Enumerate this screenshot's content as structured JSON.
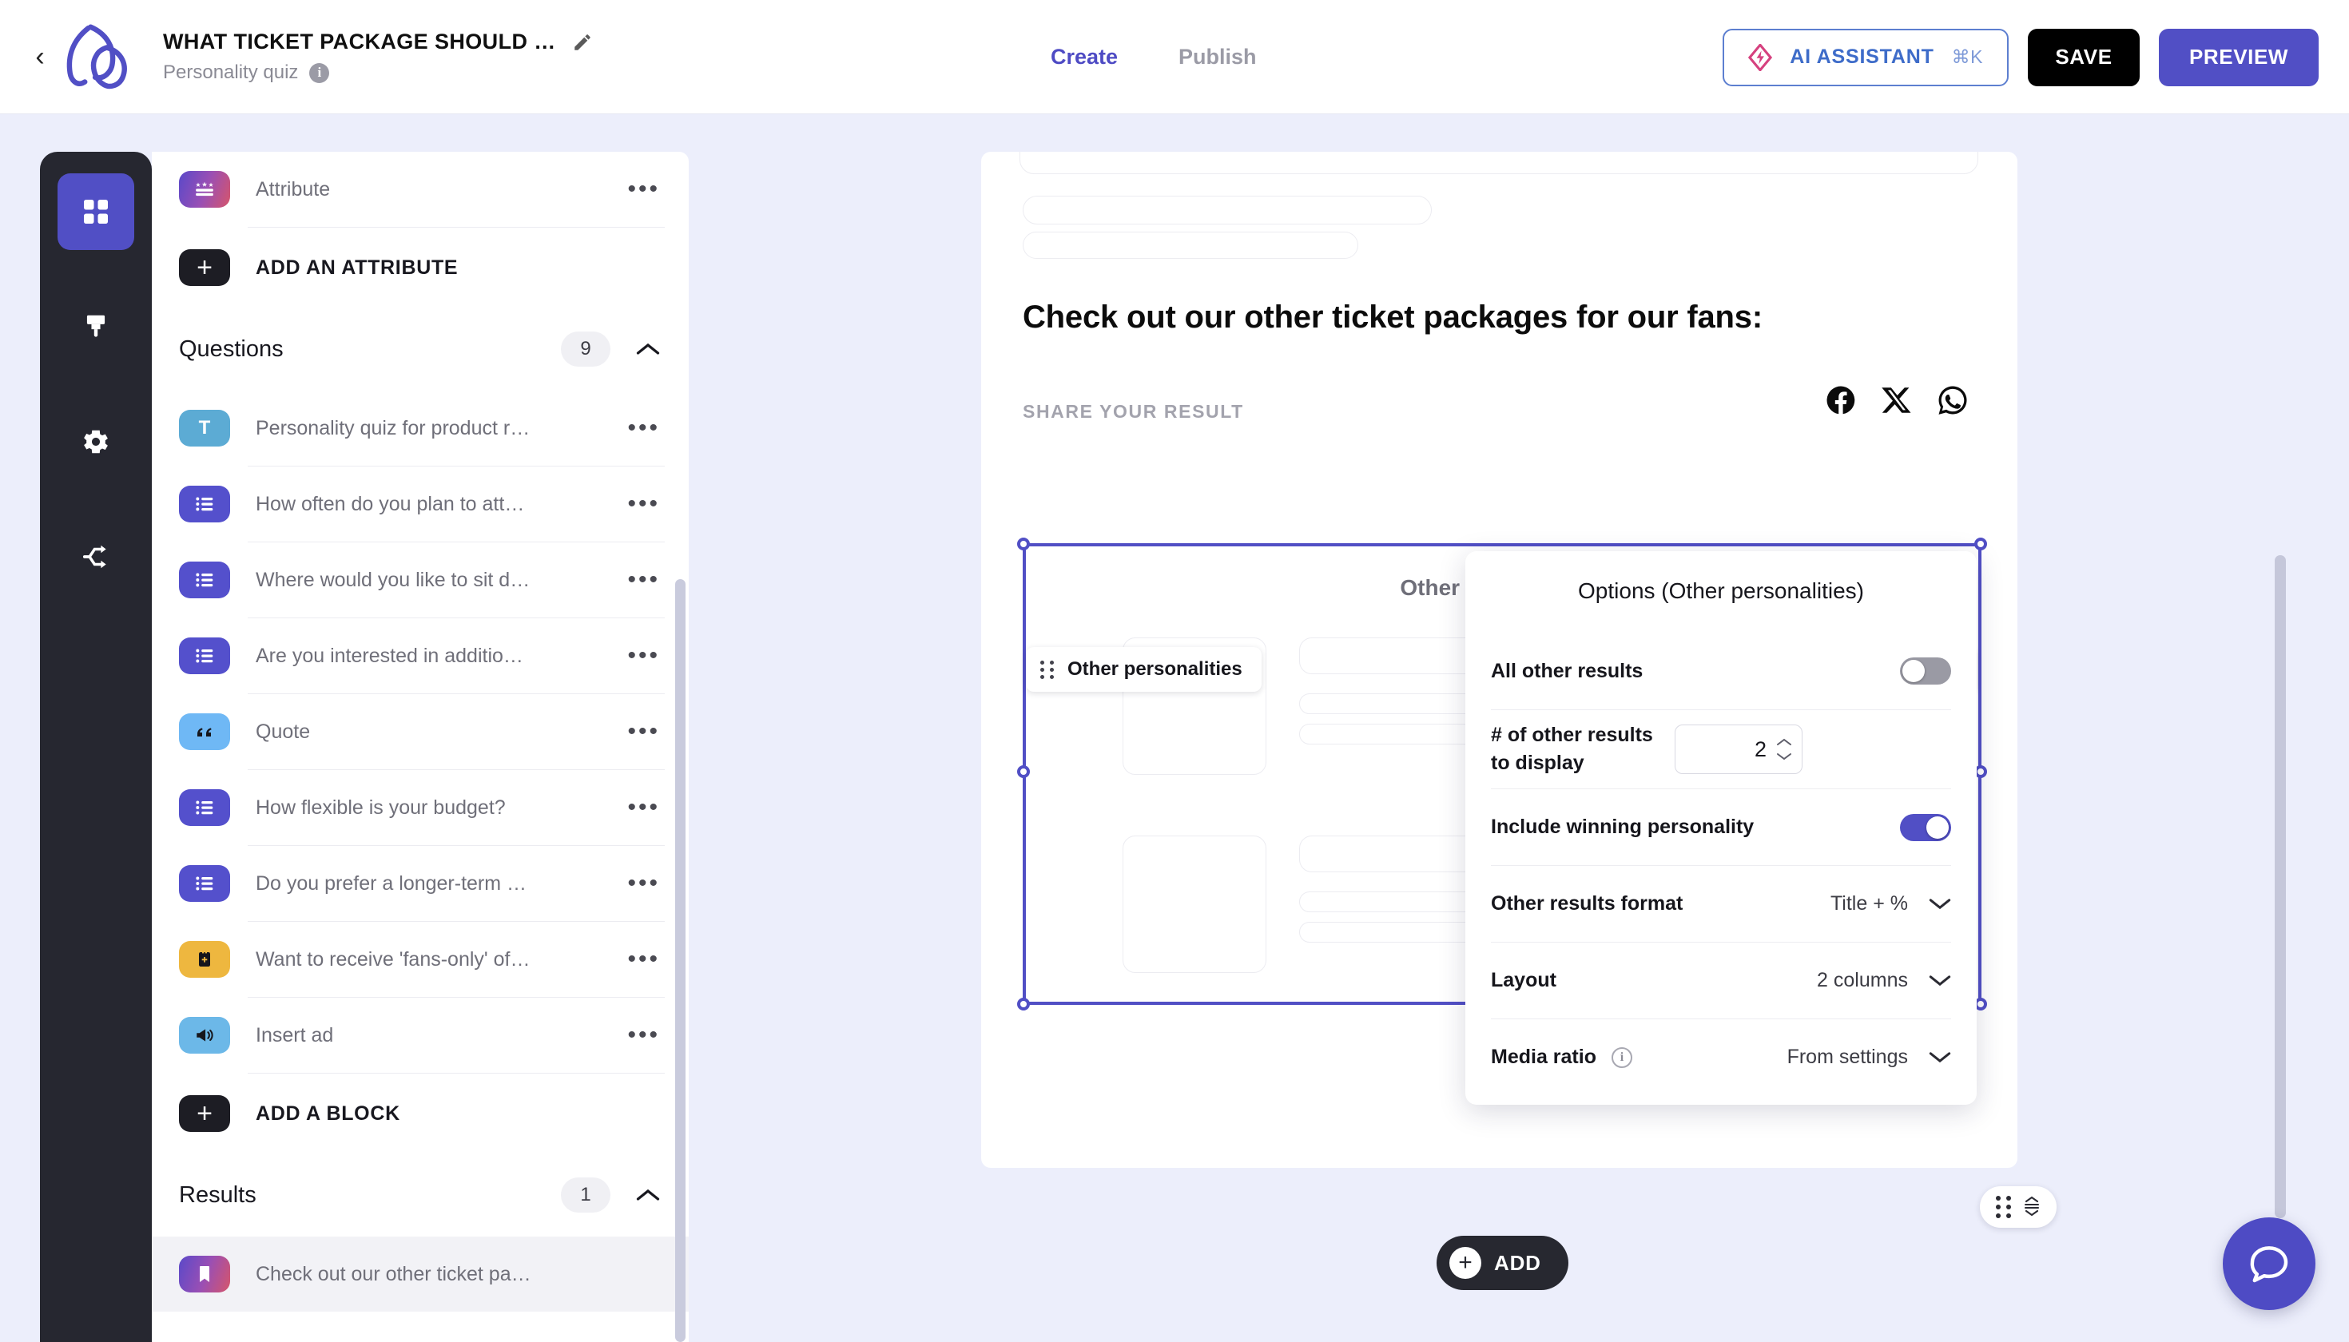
{
  "header": {
    "back_icon": "chevron-left-icon",
    "logo_icon": "brand-logo-icon",
    "title": "WHAT TICKET PACKAGE SHOULD …",
    "edit_title_icon": "pencil-icon",
    "subtitle": "Personality quiz",
    "info_icon": "info-icon",
    "info_char": "i",
    "tabs": [
      {
        "label": "Create",
        "active": true
      },
      {
        "label": "Publish",
        "active": false
      }
    ],
    "ai_button": {
      "label": "AI ASSISTANT",
      "shortcut": "⌘K",
      "icon": "ai-diamond-icon"
    },
    "save_label": "SAVE",
    "preview_label": "PREVIEW"
  },
  "rail": {
    "items": [
      {
        "name": "blocks",
        "icon": "grid-squares-icon",
        "active": true
      },
      {
        "name": "design",
        "icon": "paint-brush-icon",
        "active": false
      },
      {
        "name": "settings",
        "icon": "gear-icon",
        "active": false
      },
      {
        "name": "logic",
        "icon": "share-nodes-icon",
        "active": false
      }
    ]
  },
  "sidebar": {
    "attribute": {
      "label": "Attribute",
      "icon": "attribute-icon",
      "menu": "…"
    },
    "add_attribute_label": "ADD AN ATTRIBUTE",
    "questions_section": {
      "title": "Questions",
      "count": "9",
      "collapse_icon": "chevron-up-icon"
    },
    "questions": [
      {
        "label": "Personality quiz for product r…",
        "icon": "text-block-icon",
        "chip": "chip-text"
      },
      {
        "label": "How often do you plan to att…",
        "icon": "multiple-choice-icon",
        "chip": "chip-mc"
      },
      {
        "label": "Where would you like to sit d…",
        "icon": "multiple-choice-icon",
        "chip": "chip-mc"
      },
      {
        "label": "Are you interested in additio…",
        "icon": "multiple-choice-icon",
        "chip": "chip-mc"
      },
      {
        "label": "Quote",
        "icon": "quote-icon",
        "chip": "chip-quote"
      },
      {
        "label": "How flexible is your budget?",
        "icon": "multiple-choice-icon",
        "chip": "chip-mc"
      },
      {
        "label": "Do you prefer a longer-term …",
        "icon": "multiple-choice-icon",
        "chip": "chip-mc"
      },
      {
        "label": "Want to receive 'fans-only' of…",
        "icon": "form-icon",
        "chip": "chip-form"
      },
      {
        "label": "Insert ad",
        "icon": "megaphone-icon",
        "chip": "chip-ad"
      }
    ],
    "add_block_label": "ADD A BLOCK",
    "results_section": {
      "title": "Results",
      "count": "1",
      "collapse_icon": "chevron-up-icon"
    },
    "results": [
      {
        "label": "Check out our other ticket pa…",
        "icon": "bookmark-icon",
        "chip": "chip-result",
        "selected": true
      }
    ]
  },
  "canvas": {
    "heading": "Check out our other ticket packages for our fans:",
    "share_label": "SHARE YOUR RESULT",
    "share_icons": [
      "facebook-icon",
      "x-twitter-icon",
      "whatsapp-icon"
    ],
    "block_tag": "Other personalities",
    "block_tools": [
      "pencil-icon",
      "trash-icon"
    ],
    "other_personalities_title": "Other personalities",
    "move_pill_icons": [
      "drag-grip-icon",
      "move-vertical-icon"
    ],
    "add_fab_label": "ADD",
    "chat_icon": "chat-bubble-icon"
  },
  "options": {
    "title": "Options (Other personalities)",
    "rows": [
      {
        "label": "All other results",
        "type": "toggle",
        "value": "off"
      },
      {
        "label": "# of other results to display",
        "type": "stepper",
        "value": "2"
      },
      {
        "label": "Include winning personality",
        "type": "toggle",
        "value": "on"
      },
      {
        "label": "Other results format",
        "type": "select",
        "value": "Title + %"
      },
      {
        "label": "Layout",
        "type": "select",
        "value": "2 columns"
      },
      {
        "label": "Media ratio",
        "type": "select",
        "value": "From settings",
        "info": true
      }
    ]
  },
  "colors": {
    "accent": "#514fc5",
    "page_bg": "#eceefb",
    "rail_bg": "#262730",
    "dark_button": "#000000",
    "toggle_on": "#514fc5",
    "toggle_off": "#9a9aa4",
    "ai_border": "#5d7fd0",
    "ai_text": "#3e6cc9",
    "ai_diamond": "#d6417f"
  }
}
